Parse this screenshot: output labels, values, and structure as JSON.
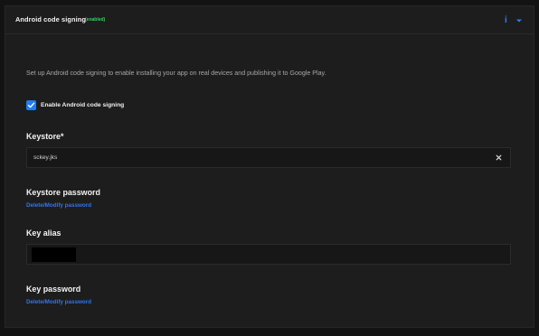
{
  "header": {
    "title": "Android code signing",
    "status": "(enabled)",
    "info_icon": "info-icon",
    "collapse_icon": "chevron-down-icon"
  },
  "main": {
    "description": "Set up Android code signing to enable installing your app on real devices and publishing it to Google Play.",
    "enable_checkbox": {
      "label": "Enable Android code signing",
      "checked": true
    },
    "keystore": {
      "label": "Keystore*",
      "value": "sckey.jks",
      "clear_icon": "close-icon"
    },
    "keystore_password": {
      "label": "Keystore password",
      "link": "Delete/Modify password"
    },
    "key_alias": {
      "label": "Key alias"
    },
    "key_password": {
      "label": "Key password",
      "link": "Delete/Modify password"
    }
  },
  "colors": {
    "accent": "#1d7ef5",
    "link": "#2d76ef",
    "status_enabled": "#2fd65f",
    "panel_bg": "#1d1d1e",
    "page_bg": "#131313"
  }
}
